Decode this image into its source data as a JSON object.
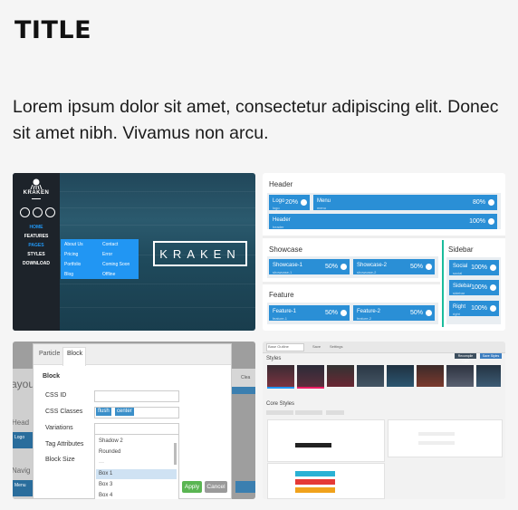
{
  "page": {
    "title": "TITLE",
    "intro": "Lorem ipsum dolor sit amet, consectetur adipiscing elit. Donec sit amet nibh. Vivamus non arcu."
  },
  "shot1": {
    "logo": "KRAKEN",
    "nav": [
      "HOME",
      "FEATURES",
      "PAGES",
      "STYLES",
      "DOWNLOAD"
    ],
    "menu_left": [
      "About Us",
      "Pricing",
      "Portfolio",
      "Blog"
    ],
    "menu_right": [
      "Contact",
      "Error",
      "Coming Soon",
      "Offline"
    ],
    "hero_text": "KRAKEN",
    "colors": {
      "accent": "#2196f3",
      "sidebar": "#1d232a"
    }
  },
  "shot2": {
    "header_title": "Header",
    "logo": {
      "label": "Logo",
      "sub": "logo",
      "pct": "20%"
    },
    "menu": {
      "label": "Menu",
      "sub": "menu",
      "pct": "80%"
    },
    "header_block": {
      "label": "Header",
      "sub": "header",
      "pct": "100%"
    },
    "showcase_title": "Showcase",
    "showcase1": {
      "label": "Showcase-1",
      "sub": "showcase-1",
      "pct": "50%"
    },
    "showcase2": {
      "label": "Showcase-2",
      "sub": "showcase-2",
      "pct": "50%"
    },
    "feature_title": "Feature",
    "feature1": {
      "label": "Feature-1",
      "sub": "feature-1",
      "pct": "50%"
    },
    "feature2": {
      "label": "Feature-2",
      "sub": "feature-2",
      "pct": "50%"
    },
    "sidebar_title": "Sidebar",
    "social": {
      "label": "Social",
      "sub": "social",
      "pct": "100%"
    },
    "sidebar_block": {
      "label": "Sidebar",
      "sub": "sidebar",
      "pct": "100%"
    },
    "right": {
      "label": "Right",
      "sub": "right",
      "pct": "100%"
    }
  },
  "shot3": {
    "tabs": [
      "Particle",
      "Block"
    ],
    "block_heading": "Block",
    "fields": [
      "CSS ID",
      "CSS Classes",
      "Variations",
      "Tag Attributes",
      "Block Size"
    ],
    "class_tags": [
      "flush",
      "center"
    ],
    "options": [
      "Shadow 2",
      "Rounded",
      "Box 1",
      "Box 3",
      "Box 4"
    ],
    "apply": "Apply",
    "cancel": "Cancel",
    "bg_texts": [
      "ayou",
      "Head",
      "Logo",
      "Navig",
      "Menu",
      "Clea"
    ]
  },
  "shot4": {
    "styles_title": "Styles",
    "core_title": "Core Styles",
    "toolbar_items": [
      "Base Outline",
      "Save",
      "Settings"
    ],
    "actions": [
      "Recompile CSS",
      "Save Styles"
    ]
  }
}
